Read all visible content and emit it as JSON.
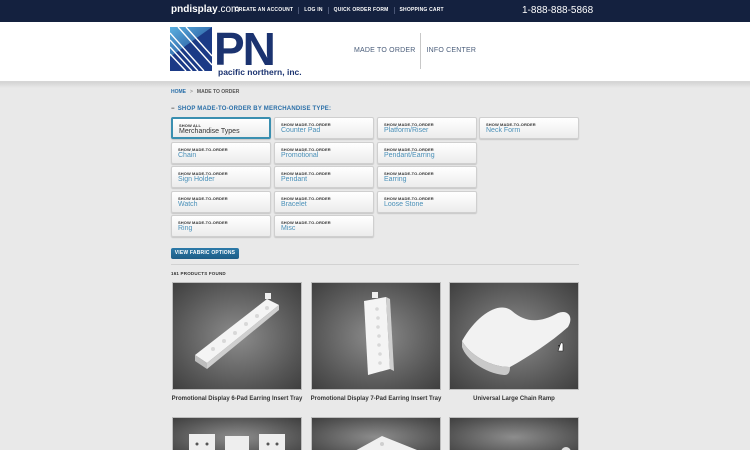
{
  "topbar": {
    "site_bold": "pndisplay",
    "site_rest": ".com",
    "nav": [
      "CREATE AN ACCOUNT",
      "LOG IN",
      "QUICK ORDER FORM",
      "SHOPPING CART"
    ],
    "phone": "1-888-888-5868"
  },
  "header": {
    "logo_letters": "PN",
    "logo_name": "pacific northern, inc.",
    "nav": [
      "MADE TO ORDER",
      "INFO CENTER"
    ]
  },
  "breadcrumb": {
    "home": "HOME",
    "separator": ">",
    "current": "MADE TO ORDER"
  },
  "section_title": {
    "toggle": "−",
    "text": "SHOP MADE-TO-ORDER BY MERCHANDISE TYPE:"
  },
  "filters": [
    {
      "pre": "SHOW ALL",
      "label": "Merchandise Types",
      "active": true
    },
    {
      "pre": "SHOW MADE-TO-ORDER",
      "label": "Counter Pad"
    },
    {
      "pre": "SHOW MADE-TO-ORDER",
      "label": "Platform/Riser"
    },
    {
      "pre": "SHOW MADE-TO-ORDER",
      "label": "Neck Form"
    },
    {
      "pre": "SHOW MADE-TO-ORDER",
      "label": "Chain"
    },
    {
      "pre": "SHOW MADE-TO-ORDER",
      "label": "Promotional"
    },
    {
      "pre": "SHOW MADE-TO-ORDER",
      "label": "Pendant/Earring"
    },
    {
      "pre": "SHOW MADE-TO-ORDER",
      "label": "Sign Holder"
    },
    {
      "pre": "SHOW MADE-TO-ORDER",
      "label": "Pendant"
    },
    {
      "pre": "SHOW MADE-TO-ORDER",
      "label": "Earring"
    },
    {
      "pre": "SHOW MADE-TO-ORDER",
      "label": "Watch"
    },
    {
      "pre": "SHOW MADE-TO-ORDER",
      "label": "Bracelet"
    },
    {
      "pre": "SHOW MADE-TO-ORDER",
      "label": "Loose Stone"
    },
    {
      "pre": "SHOW MADE-TO-ORDER",
      "label": "Ring"
    },
    {
      "pre": "SHOW MADE-TO-ORDER",
      "label": "Misc"
    }
  ],
  "fabric_button": "VIEW FABRIC OPTIONS",
  "results_count": "161 PRODUCTS FOUND",
  "products": [
    {
      "name": "Promotional Display 6-Pad Earring Insert Tray"
    },
    {
      "name": "Promotional Display 7-Pad Earring Insert Tray"
    },
    {
      "name": "Universal Large Chain Ramp"
    }
  ]
}
